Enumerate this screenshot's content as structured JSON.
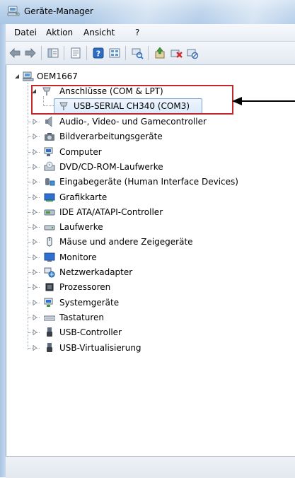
{
  "window": {
    "title": "Geräte-Manager"
  },
  "menu": {
    "items": [
      "Datei",
      "Aktion",
      "Ansicht",
      "?"
    ]
  },
  "toolbar": {
    "icons": [
      "back-icon",
      "forward-icon",
      "show-hide-tree-icon",
      "properties-icon",
      "help-icon",
      "view-icon",
      "scan-hardware-icon",
      "update-driver-icon",
      "uninstall-icon",
      "disable-icon"
    ]
  },
  "tree": {
    "root": "OEM1667",
    "expanded_category": "Anschlüsse (COM & LPT)",
    "selected_child": "USB-SERIAL CH340 (COM3)",
    "categories": [
      "Audio-, Video- und Gamecontroller",
      "Bildverarbeitungsgeräte",
      "Computer",
      "DVD/CD-ROM-Laufwerke",
      "Eingabegeräte (Human Interface Devices)",
      "Grafikkarte",
      "IDE ATA/ATAPI-Controller",
      "Laufwerke",
      "Mäuse und andere Zeigegeräte",
      "Monitore",
      "Netzwerkadapter",
      "Prozessoren",
      "Systemgeräte",
      "Tastaturen",
      "USB-Controller",
      "USB-Virtualisierung"
    ]
  },
  "colors": {
    "highlight_box": "#c0282b",
    "selection": "#dcebfc"
  }
}
